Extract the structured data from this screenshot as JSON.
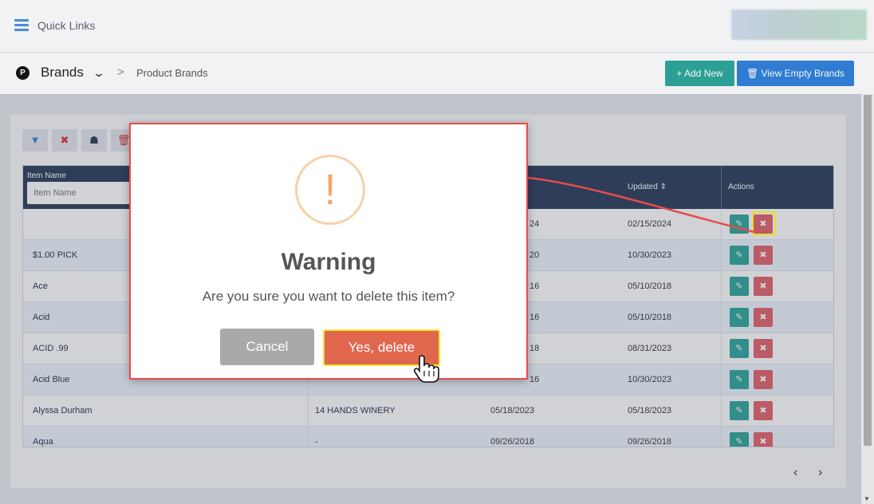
{
  "topbar": {
    "quick_links": "Quick Links"
  },
  "breadcrumb": {
    "main": "Brands",
    "separator": ">",
    "sub": "Product Brands"
  },
  "actions": {
    "add_new": "+ Add New",
    "view_empty": "🗑 View Empty Brands"
  },
  "grid": {
    "headers": {
      "item_name": "Item Name",
      "updated": "Updated ⇕",
      "actions": "Actions"
    },
    "filter_placeholder": "Item Name",
    "rows": [
      {
        "name": "",
        "brand": "",
        "created": "24",
        "updated": "02/15/2024"
      },
      {
        "name": "$1.00 PICK",
        "brand": "",
        "created": "20",
        "updated": "10/30/2023"
      },
      {
        "name": "Ace",
        "brand": "",
        "created": "16",
        "updated": "05/10/2018"
      },
      {
        "name": "Acid",
        "brand": "",
        "created": "16",
        "updated": "05/10/2018"
      },
      {
        "name": "ACID .99",
        "brand": "",
        "created": "18",
        "updated": "08/31/2023"
      },
      {
        "name": "Acid Blue",
        "brand": "",
        "created": "16",
        "updated": "10/30/2023"
      },
      {
        "name": "Alyssa Durham",
        "brand": "14 HANDS WINERY",
        "created": "05/18/2023",
        "updated": "05/18/2023"
      },
      {
        "name": "Aqua",
        "brand": "-",
        "created": "09/26/2018",
        "updated": "09/26/2018"
      }
    ]
  },
  "pager": {
    "prev": "‹",
    "next": "›"
  },
  "modal": {
    "icon": "!",
    "title": "Warning",
    "message": "Are you sure you want to delete this item?",
    "cancel": "Cancel",
    "confirm": "Yes, delete"
  },
  "colors": {
    "accent_teal": "#2ba49a",
    "accent_blue": "#2f7fd8",
    "danger": "#e0674e",
    "highlight": "#f1e537"
  }
}
